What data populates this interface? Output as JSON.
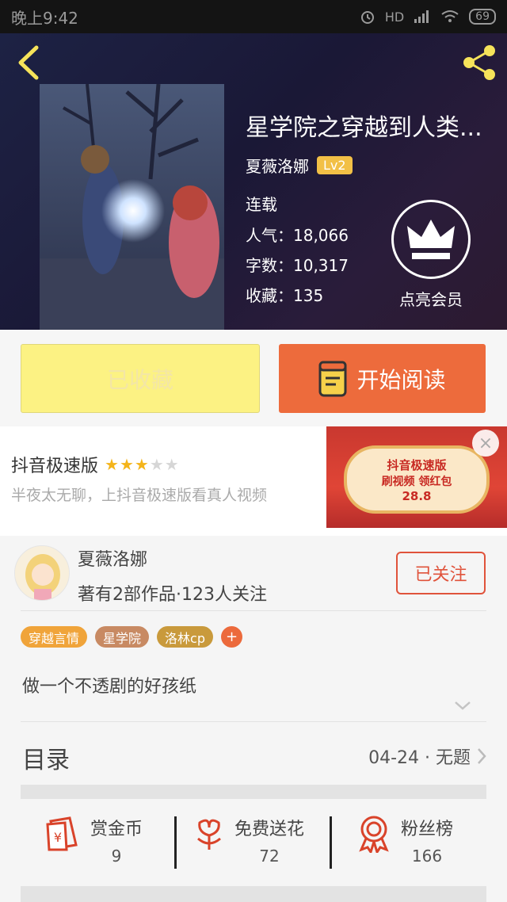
{
  "status_bar": {
    "time": "晚上9:42",
    "network": "HD",
    "battery": "69"
  },
  "book": {
    "title": "星学院之穿越到人类...",
    "author": "夏薇洛娜",
    "level": "Lv2",
    "status": "连载",
    "popularity": "人气：18,066",
    "word_count": "字数：10,317",
    "favorites": "收藏：135"
  },
  "vip": {
    "label": "点亮会员"
  },
  "actions": {
    "collected": "已收藏",
    "read": "开始阅读"
  },
  "ad": {
    "title": "抖音极速版",
    "rating": 3,
    "rating_max": 5,
    "description": "半夜太无聊，上抖音极速版看真人视频",
    "banner_title": "抖音极速版",
    "banner_sub": "刷视频 领红包",
    "banner_amount": "28.8"
  },
  "author_info": {
    "name": "夏薇洛娜",
    "meta": "著有2部作品·123人关注",
    "follow": "已关注"
  },
  "tags": [
    {
      "label": "穿越言情",
      "color": "#f0a43a"
    },
    {
      "label": "星学院",
      "color": "#c88a63"
    },
    {
      "label": "洛林cp",
      "color": "#c99a3c"
    }
  ],
  "tag_add": "+",
  "intro": "做一个不透剧的好孩纸",
  "toc": {
    "label": "目录",
    "latest": "04-24 · 无题"
  },
  "stats": [
    {
      "label": "赏金币",
      "value": "9",
      "icon": "red-envelope-icon"
    },
    {
      "label": "免费送花",
      "value": "72",
      "icon": "flower-icon"
    },
    {
      "label": "粉丝榜",
      "value": "166",
      "icon": "medal-icon"
    }
  ],
  "colors": {
    "accent": "#ed6b3c",
    "follow": "#e0533b",
    "collected_bg": "#fcf283",
    "icon_red": "#d9432a"
  }
}
